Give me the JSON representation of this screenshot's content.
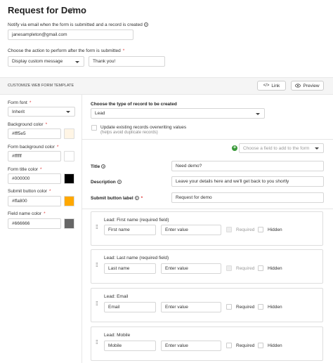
{
  "header": {
    "title": "Request for Demo"
  },
  "notify": {
    "label": "Notify via email when the form is submitted and a record is created",
    "email": "janesampleton@gmail.com"
  },
  "action": {
    "label": "Choose the action to perform after the form is submitted",
    "selected": "Display custom message",
    "message": "Thank you!"
  },
  "customize": {
    "title": "CUSTOMIZE WEB FORM TEMPLATE",
    "link_button": "Link",
    "preview_button": "Preview"
  },
  "sidebar": {
    "font_label": "Form font",
    "font_value": "Inherit",
    "bg_label": "Background color",
    "bg_value": "#fff5e5",
    "formbg_label": "Form background color",
    "formbg_value": "#ffffff",
    "titlecolor_label": "Form title color",
    "titlecolor_value": "#000000",
    "submitcolor_label": "Submit button color",
    "submitcolor_value": "#ffa800",
    "fieldcolor_label": "Field name color",
    "fieldcolor_value": "#666666"
  },
  "colors": {
    "bg": "#fff5e5",
    "formbg": "#ffffff",
    "titlecolor": "#000000",
    "submitcolor": "#ffa800",
    "fieldcolor": "#666666",
    "required_mark": "#e03a3a",
    "add_icon": "#3a9a3a"
  },
  "record": {
    "type_label": "Choose the type of record to be created",
    "type_value": "Lead",
    "update_label": "Update existing records overwriting values",
    "update_hint": "(helps avoid duplicate records)"
  },
  "add_field": {
    "placeholder": "Choose a field to add to the form"
  },
  "form_settings": {
    "title_label": "Title",
    "title_value": "Need demo?",
    "desc_label": "Description",
    "desc_value": "Leave your details here and we'll get back to you shortly",
    "submit_label": "Submit button label",
    "submit_value": "Request for demo"
  },
  "field_cards": [
    {
      "title": "Lead: First name (required field)",
      "name": "First name",
      "placeholder": "Enter value",
      "required": "Required",
      "hidden": "Hidden"
    },
    {
      "title": "Lead: Last name (required field)",
      "name": "Last name",
      "placeholder": "Enter value",
      "required": "Required",
      "hidden": "Hidden"
    },
    {
      "title": "Lead: Email",
      "name": "Email",
      "placeholder": "Enter value",
      "required": "Required",
      "hidden": "Hidden"
    },
    {
      "title": "Lead: Mobile",
      "name": "Mobile",
      "placeholder": "Enter value",
      "required": "Required",
      "hidden": "Hidden"
    }
  ]
}
